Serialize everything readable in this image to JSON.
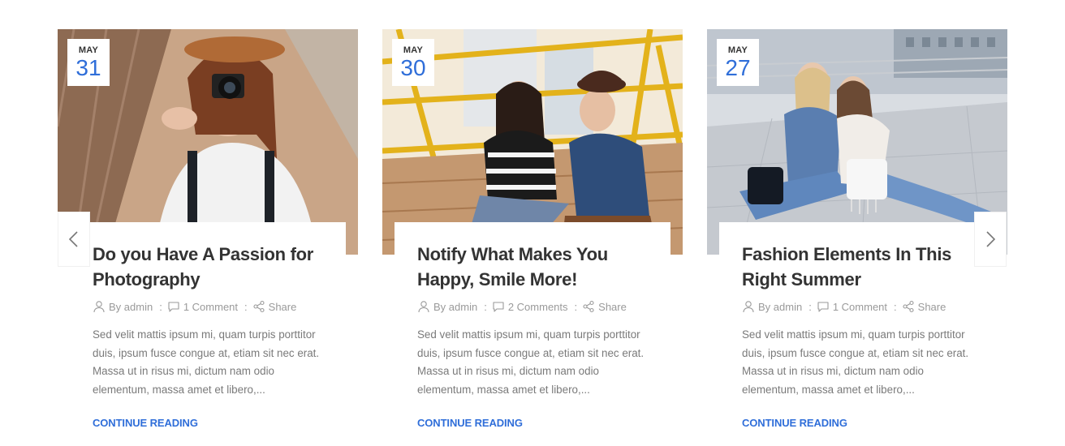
{
  "colors": {
    "accent": "#2f6ed9",
    "title": "#333333",
    "meta": "#9a9a9a",
    "excerpt": "#7a7a7a"
  },
  "carousel": {
    "prev_icon": "chevron-left-icon",
    "next_icon": "chevron-right-icon"
  },
  "posts": [
    {
      "date": {
        "month": "MAY",
        "day": "31"
      },
      "title": "Do you Have A Passion for Photography",
      "meta": {
        "author": "By admin",
        "comments": "1 Comment",
        "share": "Share"
      },
      "excerpt": "Sed velit mattis ipsum mi, quam turpis porttitor duis, ipsum fusce congue at, etiam sit nec erat. Massa ut in risus mi, dictum nam odio elementum, massa amet et libero,...",
      "read_more": "CONTINUE READING"
    },
    {
      "date": {
        "month": "MAY",
        "day": "30"
      },
      "title": "Notify What Makes You Happy, Smile More!",
      "meta": {
        "author": "By admin",
        "comments": "2 Comments",
        "share": "Share"
      },
      "excerpt": "Sed velit mattis ipsum mi, quam turpis porttitor duis, ipsum fusce congue at, etiam sit nec erat. Massa ut in risus mi, dictum nam odio elementum, massa amet et libero,...",
      "read_more": "CONTINUE READING"
    },
    {
      "date": {
        "month": "MAY",
        "day": "27"
      },
      "title": "Fashion Elements In This Right Summer",
      "meta": {
        "author": "By admin",
        "comments": "1 Comment",
        "share": "Share"
      },
      "excerpt": "Sed velit mattis ipsum mi, quam turpis porttitor duis, ipsum fusce congue at, etiam sit nec erat. Massa ut in risus mi, dictum nam odio elementum, massa amet et libero,...",
      "read_more": "CONTINUE READING"
    }
  ]
}
